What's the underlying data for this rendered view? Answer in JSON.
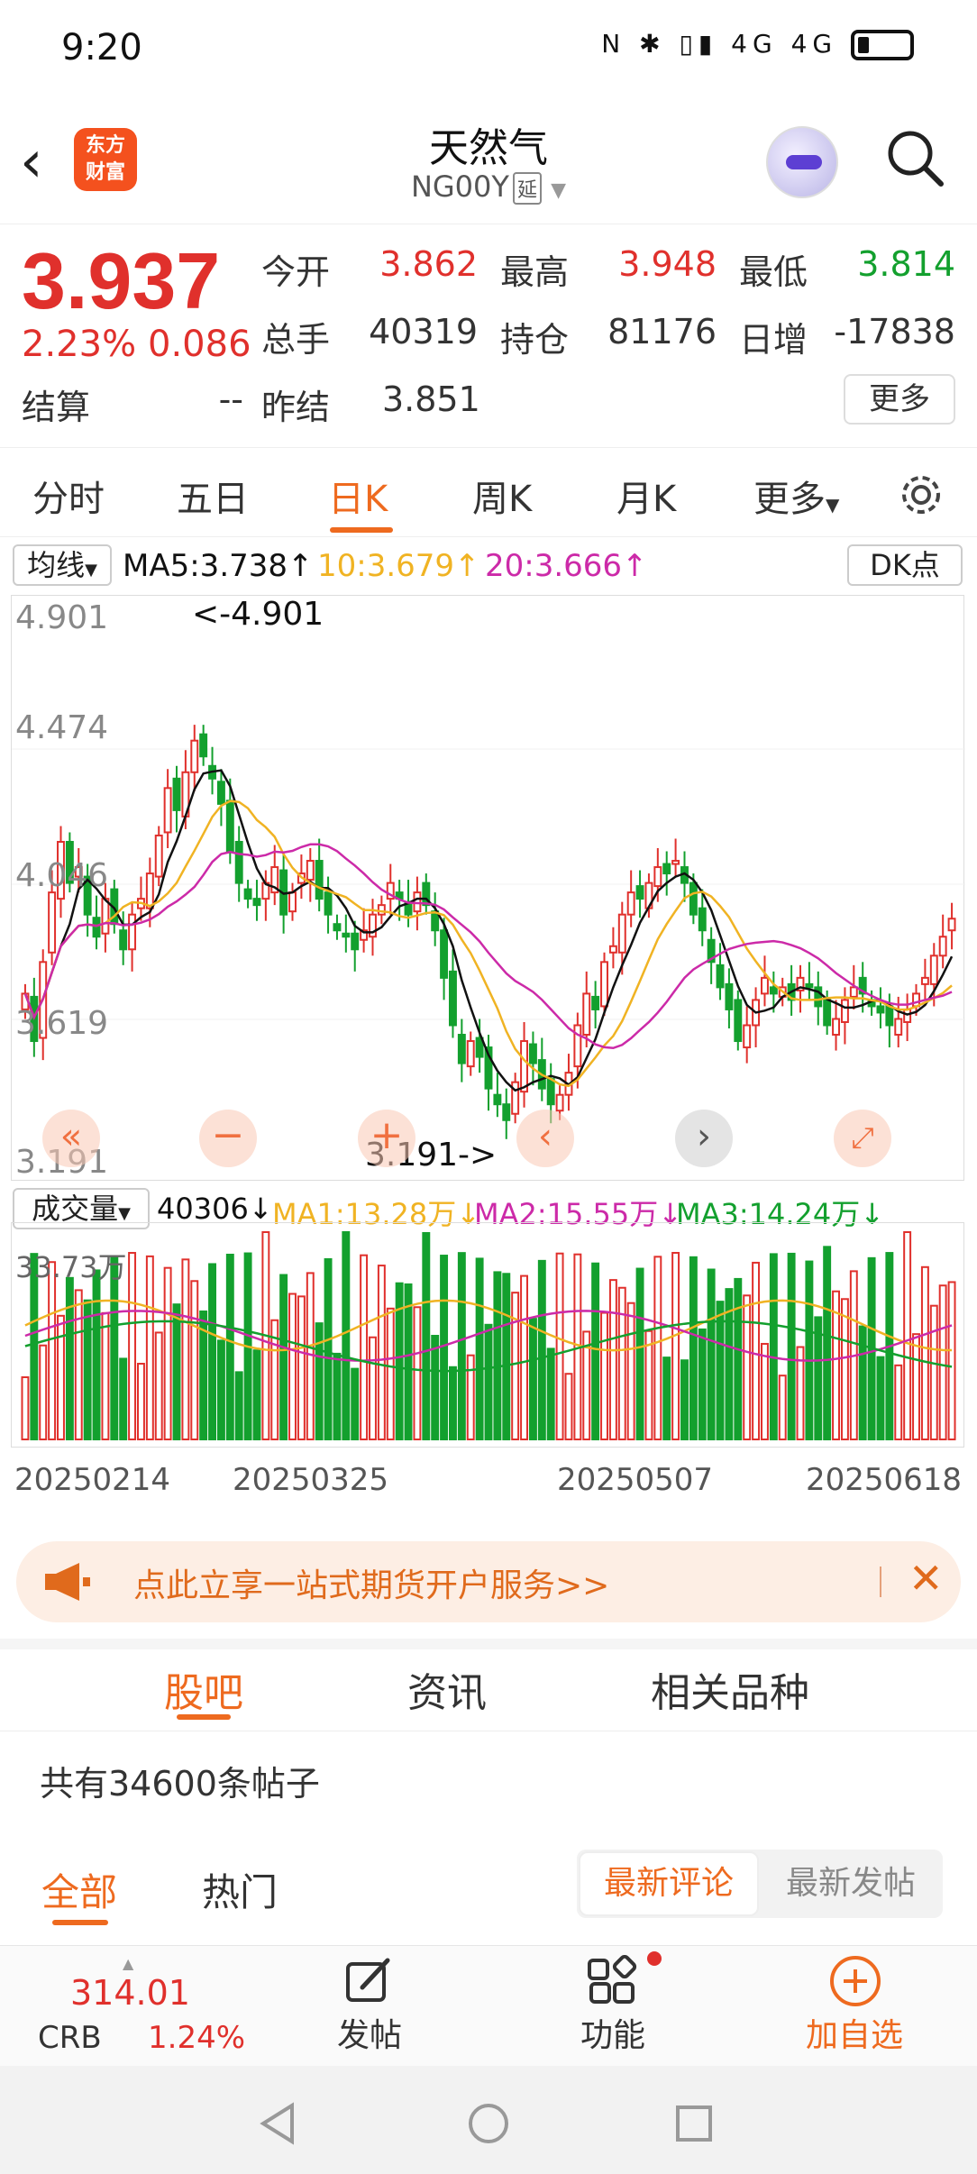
{
  "status_bar": {
    "time": "9:20",
    "icons": "N ✱ ▯▮ 4G 4G"
  },
  "header": {
    "back_icon": "chevron-left-icon",
    "logo_line1": "东方",
    "logo_line2": "财富",
    "title": "天然气",
    "code": "NG00Y",
    "delay_tag": "延"
  },
  "quote": {
    "price": "3.937",
    "change_pct": "2.23%",
    "change": "0.086",
    "open_label": "今开",
    "open": "3.862",
    "high_label": "最高",
    "high": "3.948",
    "low_label": "最低",
    "low": "3.814",
    "volume_label": "总手",
    "volume": "40319",
    "oi_label": "持仓",
    "oi": "81176",
    "oi_change_label": "日增",
    "oi_change": "-17838",
    "settle_label": "结算",
    "settle": "--",
    "prev_settle_label": "昨结",
    "prev_settle": "3.851",
    "more_button": "更多"
  },
  "tabs": [
    "分时",
    "五日",
    "日K",
    "周K",
    "月K",
    "更多"
  ],
  "active_tab": "日K",
  "ma_bar": {
    "selector": "均线",
    "ma5": "MA5:3.738↑",
    "ma10": "10:3.679↑",
    "ma20": "20:3.666↑",
    "dk": "DK点"
  },
  "price_axis": [
    "4.901",
    "4.474",
    "4.046",
    "3.619",
    "3.191"
  ],
  "annotations": {
    "max_label": "<-4.901",
    "min_label": "3.191->"
  },
  "vol_bar": {
    "selector": "成交量",
    "vol": "40306↓",
    "ma1": "MA1:13.28万↓",
    "ma2": "MA2:15.55万↓",
    "ma3": "MA3:14.24万↓",
    "axis_max": "33.73万"
  },
  "dates": [
    "20250214",
    "20250325",
    "20250507",
    "20250618"
  ],
  "colors": {
    "up": "#e0302c",
    "down": "#13a02e",
    "ma5": "#111111",
    "ma10": "#f0b323",
    "ma20": "#cc2aa8",
    "accent": "#ee6a1f"
  },
  "chart_data": {
    "type": "candlestick",
    "ylim": [
      3.191,
      4.901
    ],
    "x_ticks": [
      "20250214",
      "20250325",
      "20250507",
      "20250618"
    ],
    "highest": 4.901,
    "lowest": 3.191,
    "last_close": 3.937,
    "ma5_last": 3.738,
    "ma10_last": 3.679,
    "ma20_last": 3.666,
    "closes": [
      3.7,
      3.55,
      3.8,
      4.02,
      4.18,
      4.05,
      4.1,
      3.95,
      3.88,
      4.0,
      3.92,
      3.84,
      3.95,
      4.0,
      4.08,
      4.2,
      4.35,
      4.28,
      4.4,
      4.5,
      4.45,
      4.38,
      4.3,
      4.15,
      4.05,
      4.0,
      3.98,
      4.05,
      4.1,
      3.95,
      4.02,
      4.08,
      4.12,
      4.0,
      3.95,
      3.9,
      3.88,
      3.84,
      3.9,
      3.95,
      3.98,
      4.05,
      4.0,
      3.95,
      4.02,
      3.98,
      3.9,
      3.75,
      3.6,
      3.48,
      3.55,
      3.5,
      3.4,
      3.35,
      3.3,
      3.42,
      3.55,
      3.48,
      3.4,
      3.35,
      3.38,
      3.45,
      3.6,
      3.7,
      3.65,
      3.8,
      3.85,
      3.95,
      4.02,
      4.0,
      4.05,
      4.1,
      4.08,
      4.12,
      4.05,
      3.95,
      3.9,
      3.8,
      3.72,
      3.65,
      3.55,
      3.6,
      3.68,
      3.75,
      3.7,
      3.72,
      3.68,
      3.75,
      3.72,
      3.66,
      3.6,
      3.62,
      3.68,
      3.72,
      3.7,
      3.66,
      3.64,
      3.6,
      3.62,
      3.65,
      3.7,
      3.75,
      3.82,
      3.88,
      3.937
    ],
    "volume_max": "33.73万",
    "vol_ma1": "13.28万",
    "vol_ma2": "15.55万",
    "vol_ma3": "14.24万"
  },
  "banner": {
    "text": "点此立享一站式期货开户服务>>",
    "close_icon": "close-icon"
  },
  "forum_tabs": [
    "股吧",
    "资讯",
    "相关品种"
  ],
  "forum_count": "共有34600条帖子",
  "sub_tabs": {
    "all": "全部",
    "hot": "热门",
    "latest_comment": "最新评论",
    "latest_post": "最新发帖"
  },
  "bottom_nav": {
    "crb_value": "314.01",
    "crb_label": "CRB",
    "crb_pct": "1.24%",
    "post": "发帖",
    "functions": "功能",
    "add_watch": "加自选"
  }
}
